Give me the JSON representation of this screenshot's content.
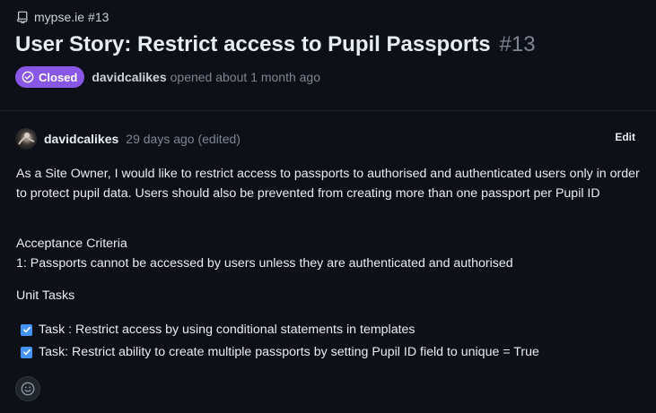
{
  "repo": {
    "name": "mypse.ie",
    "issue_ref": "#13",
    "icon": "repo-icon"
  },
  "issue": {
    "title": "User Story: Restrict access to Pupil Passports",
    "number": "#13",
    "status": "Closed",
    "status_color": "#8957e5",
    "author": "davidcalikes",
    "opened_text": "opened about 1 month ago"
  },
  "comment": {
    "author": "davidcalikes",
    "time": "29 days ago (edited)",
    "edit_label": "Edit",
    "paragraph": "As a Site Owner, I would like to restrict access to passports to authorised and authenticated users only in order to protect pupil data. Users should also be prevented from creating more than one passport per Pupil ID",
    "criteria_heading": "Acceptance Criteria",
    "criteria_1": "1: Passports cannot be accessed by users unless they are authenticated and authorised",
    "unit_tasks_heading": "Unit Tasks",
    "tasks": [
      {
        "label": "Task : Restrict access by using conditional statements in templates",
        "checked": true
      },
      {
        "label": "Task: Restrict ability to create multiple passports by setting Pupil ID field to unique = True",
        "checked": true
      }
    ],
    "reaction_icon": "smiley-icon"
  },
  "colors": {
    "background": "#0d1117",
    "accent": "#4493f8",
    "muted": "#7d8590"
  }
}
